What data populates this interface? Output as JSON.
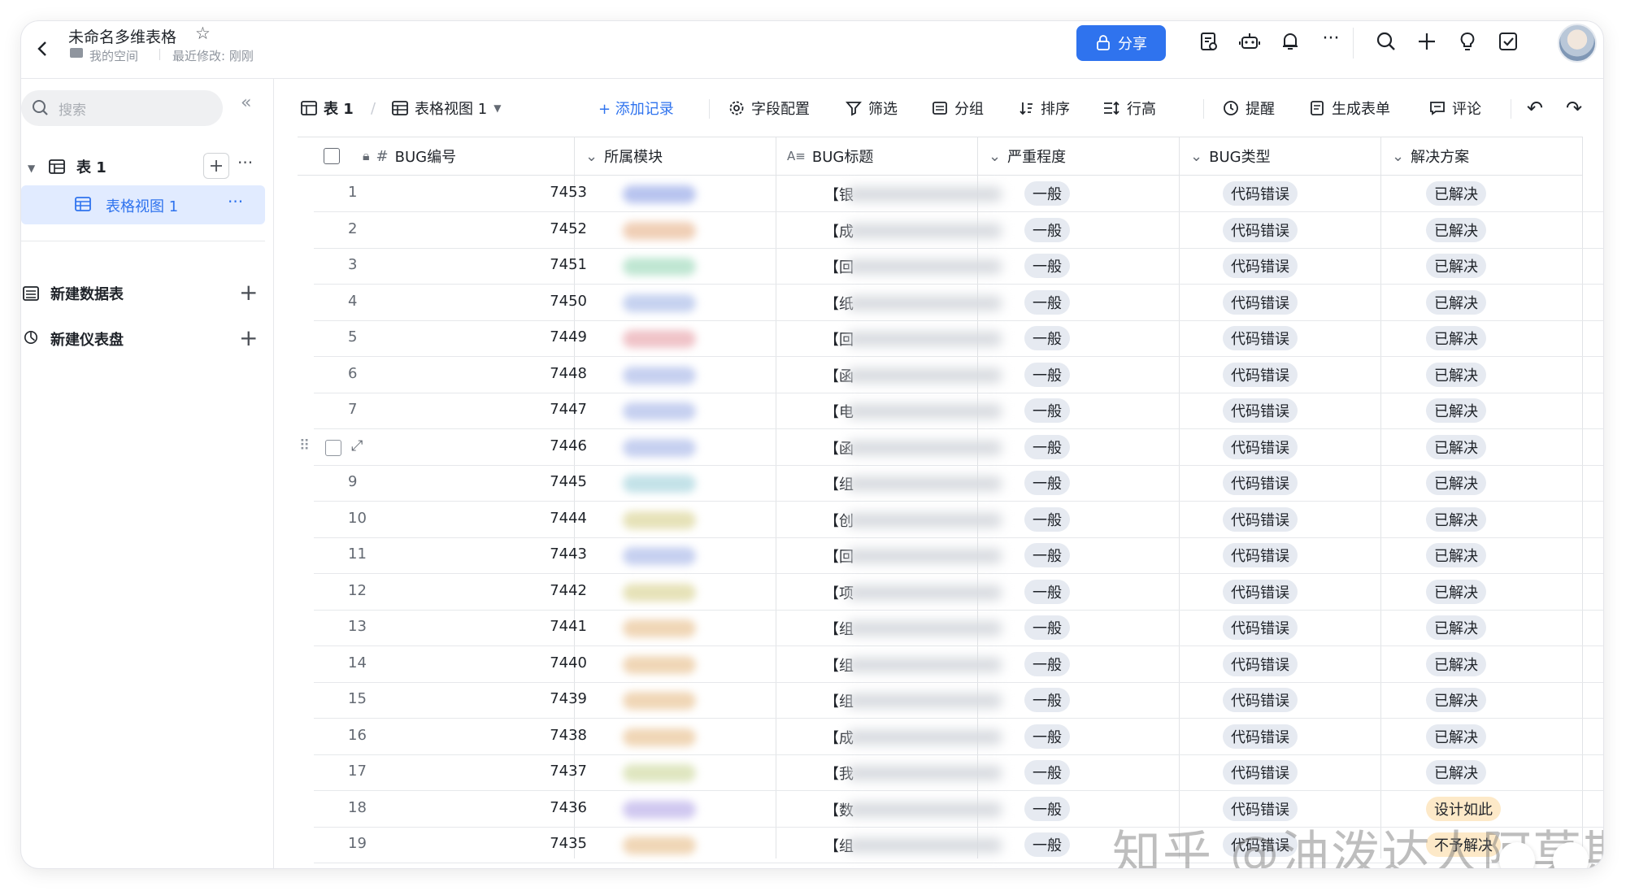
{
  "header": {
    "title": "未命名多维表格",
    "space": "我的空间",
    "modified": "最近修改: 刚刚",
    "share_label": "分享"
  },
  "sidebar": {
    "search_placeholder": "搜索",
    "table_name": "表 1",
    "view_name": "表格视图 1",
    "new_table": "新建数据表",
    "new_dashboard": "新建仪表盘"
  },
  "toolbar": {
    "table": "表 1",
    "view": "表格视图 1",
    "add_record": "+ 添加记录",
    "field_config": "字段配置",
    "filter": "筛选",
    "group": "分组",
    "sort": "排序",
    "row_height": "行高",
    "reminder": "提醒",
    "form": "生成表单",
    "comment": "评论"
  },
  "columns": {
    "bug_id": "BUG编号",
    "module": "所属模块",
    "bug_title": "BUG标题",
    "severity": "严重程度",
    "bug_type": "BUG类型",
    "solution": "解决方案"
  },
  "rows": [
    {
      "n": "1",
      "id": "7453",
      "t": "【银",
      "sev": "一般",
      "type": "代码错误",
      "sol": "已解决",
      "c": "#b8c4ef"
    },
    {
      "n": "2",
      "id": "7452",
      "t": "【成",
      "sev": "一般",
      "type": "代码错误",
      "sol": "已解决",
      "c": "#f0cfb6"
    },
    {
      "n": "3",
      "id": "7451",
      "t": "【回",
      "sev": "一般",
      "type": "代码错误",
      "sol": "已解决",
      "c": "#bfe6d2"
    },
    {
      "n": "4",
      "id": "7450",
      "t": "【纸",
      "sev": "一般",
      "type": "代码错误",
      "sol": "已解决",
      "c": "#c6d2f0"
    },
    {
      "n": "5",
      "id": "7449",
      "t": "【回",
      "sev": "一般",
      "type": "代码错误",
      "sol": "已解决",
      "c": "#f0c3c8"
    },
    {
      "n": "6",
      "id": "7448",
      "t": "【函",
      "sev": "一般",
      "type": "代码错误",
      "sol": "已解决",
      "c": "#c6d0f0"
    },
    {
      "n": "7",
      "id": "7447",
      "t": "【电",
      "sev": "一般",
      "type": "代码错误",
      "sol": "已解决",
      "c": "#c6d0f0"
    },
    {
      "n": "",
      "id": "7446",
      "t": "【函",
      "sev": "一般",
      "type": "代码错误",
      "sol": "已解决",
      "c": "#c6d0f0"
    },
    {
      "n": "9",
      "id": "7445",
      "t": "【组",
      "sev": "一般",
      "type": "代码错误",
      "sol": "已解决",
      "c": "#c3e2e8"
    },
    {
      "n": "10",
      "id": "7444",
      "t": "【创",
      "sev": "一般",
      "type": "代码错误",
      "sol": "已解决",
      "c": "#e6e2b8"
    },
    {
      "n": "11",
      "id": "7443",
      "t": "【回",
      "sev": "一般",
      "type": "代码错误",
      "sol": "已解决",
      "c": "#c6d0f0"
    },
    {
      "n": "12",
      "id": "7442",
      "t": "【项",
      "sev": "一般",
      "type": "代码错误",
      "sol": "已解决",
      "c": "#e6e2b8"
    },
    {
      "n": "13",
      "id": "7441",
      "t": "【组",
      "sev": "一般",
      "type": "代码错误",
      "sol": "已解决",
      "c": "#f0d6b6"
    },
    {
      "n": "14",
      "id": "7440",
      "t": "【组",
      "sev": "一般",
      "type": "代码错误",
      "sol": "已解决",
      "c": "#f0d6b6"
    },
    {
      "n": "15",
      "id": "7439",
      "t": "【组",
      "sev": "一般",
      "type": "代码错误",
      "sol": "已解决",
      "c": "#f0d6b6"
    },
    {
      "n": "16",
      "id": "7438",
      "t": "【成",
      "sev": "一般",
      "type": "代码错误",
      "sol": "已解决",
      "c": "#f0d6b6"
    },
    {
      "n": "17",
      "id": "7437",
      "t": "【我",
      "sev": "一般",
      "type": "代码错误",
      "sol": "已解决",
      "c": "#dfe6c0"
    },
    {
      "n": "18",
      "id": "7436",
      "t": "【数",
      "sev": "一般",
      "type": "代码错误",
      "sol": "设计如此",
      "c": "#d0c8f0"
    },
    {
      "n": "19",
      "id": "7435",
      "t": "【组",
      "sev": "一般",
      "type": "代码错误",
      "sol": "不予解决",
      "c": "#f0d6b6"
    }
  ],
  "watermark": "知乎 @油泼达人阿莫斯",
  "colors": {
    "accent": "#2f73ee",
    "tag_bg": "#e6eaf1",
    "selected_bg": "#e1ebff"
  }
}
